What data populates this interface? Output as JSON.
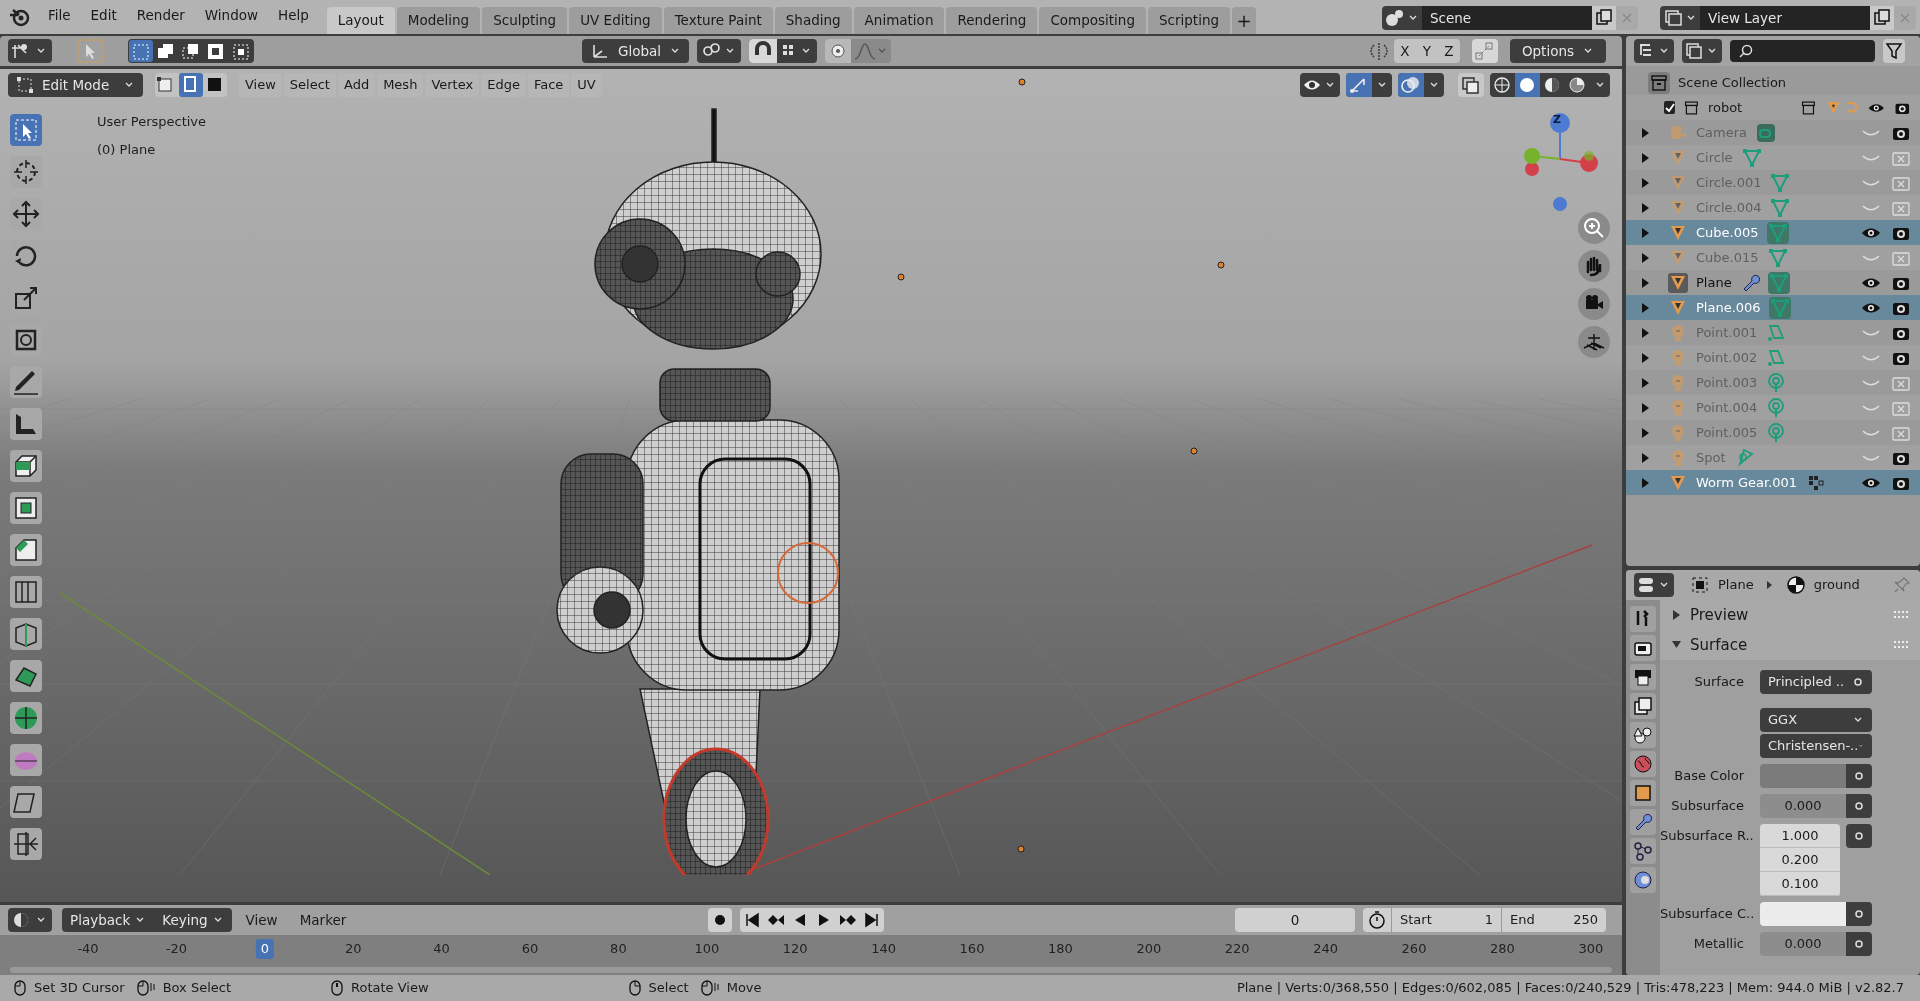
{
  "top_bar": {
    "menus": [
      "File",
      "Edit",
      "Render",
      "Window",
      "Help"
    ],
    "workspaces": [
      {
        "label": "Layout",
        "selected": true
      },
      {
        "label": "Modeling",
        "selected": false
      },
      {
        "label": "Sculpting",
        "selected": false
      },
      {
        "label": "UV Editing",
        "selected": false
      },
      {
        "label": "Texture Paint",
        "selected": false
      },
      {
        "label": "Shading",
        "selected": false
      },
      {
        "label": "Animation",
        "selected": false
      },
      {
        "label": "Rendering",
        "selected": false
      },
      {
        "label": "Compositing",
        "selected": false
      },
      {
        "label": "Scripting",
        "selected": false
      }
    ],
    "add_tab": "+",
    "scene": "Scene",
    "view_layer": "View Layer"
  },
  "viewport": {
    "orientation": "Global",
    "axes": [
      "X",
      "Y",
      "Z"
    ],
    "options": "Options",
    "mode": "Edit Mode",
    "select_modes": [
      {
        "selected": false
      },
      {
        "selected": true
      },
      {
        "selected": false
      }
    ],
    "menus": [
      "View",
      "Select",
      "Add",
      "Mesh",
      "Vertex",
      "Edge",
      "Face",
      "UV"
    ],
    "shading": [
      {
        "selected": false
      },
      {
        "selected": true
      },
      {
        "selected": false
      },
      {
        "selected": false
      }
    ],
    "toggles": {
      "gizmos": true,
      "overlays": true,
      "xray": false
    },
    "overlay_text": [
      "User Perspective",
      "(0) Plane"
    ],
    "gizmo_label": "Z",
    "tools": [
      {
        "kind": "select",
        "selected": true
      },
      {
        "kind": "cursor",
        "selected": false
      },
      {
        "kind": "move",
        "selected": false
      },
      {
        "kind": "rotate",
        "selected": false
      },
      {
        "kind": "scale",
        "selected": false
      },
      {
        "kind": "transform",
        "selected": false
      },
      {
        "kind": "annotate",
        "selected": false
      },
      {
        "kind": "measure",
        "selected": false
      },
      {
        "kind": "extrude",
        "selected": false
      },
      {
        "kind": "inset",
        "selected": false
      },
      {
        "kind": "bevel",
        "selected": false
      },
      {
        "kind": "loopcut",
        "selected": false
      },
      {
        "kind": "knife",
        "selected": false
      },
      {
        "kind": "polybuild",
        "selected": false
      },
      {
        "kind": "spin",
        "selected": false
      },
      {
        "kind": "smooth",
        "selected": false
      },
      {
        "kind": "shear",
        "selected": false
      },
      {
        "kind": "rip",
        "selected": false
      }
    ]
  },
  "outliner": {
    "root": "Scene Collection",
    "collection": {
      "name": "robot",
      "checked": true,
      "children": [
        {
          "name": "Camera",
          "kind": "camera",
          "data": {
            "kind": "camera"
          },
          "visible": false,
          "renderable": true,
          "selected": false,
          "active": false
        },
        {
          "name": "Circle",
          "kind": "mesh",
          "data": {
            "kind": "mesh"
          },
          "visible": false,
          "renderable": false,
          "selected": false,
          "active": false
        },
        {
          "name": "Circle.001",
          "kind": "mesh",
          "data": {
            "kind": "mesh"
          },
          "visible": false,
          "renderable": false,
          "selected": false,
          "active": false
        },
        {
          "name": "Circle.004",
          "kind": "mesh",
          "data": {
            "kind": "mesh"
          },
          "visible": false,
          "renderable": false,
          "selected": false,
          "active": false
        },
        {
          "name": "Cube.005",
          "kind": "mesh",
          "data": {
            "kind": "mesh"
          },
          "visible": true,
          "renderable": true,
          "selected": true,
          "active": false
        },
        {
          "name": "Cube.015",
          "kind": "mesh",
          "data": {
            "kind": "mesh"
          },
          "visible": false,
          "renderable": false,
          "selected": false,
          "active": false
        },
        {
          "name": "Plane",
          "kind": "mesh",
          "data": {
            "kind": "mesh"
          },
          "modifier": true,
          "visible": true,
          "renderable": true,
          "selected": false,
          "active": true
        },
        {
          "name": "Plane.006",
          "kind": "mesh",
          "data": {
            "kind": "mesh"
          },
          "visible": true,
          "renderable": true,
          "selected": true,
          "active": false
        },
        {
          "name": "Point.001",
          "kind": "light",
          "data": {
            "kind": "area"
          },
          "visible": false,
          "renderable": true,
          "selected": false,
          "active": false
        },
        {
          "name": "Point.002",
          "kind": "light",
          "data": {
            "kind": "area"
          },
          "visible": false,
          "renderable": true,
          "selected": false,
          "active": false
        },
        {
          "name": "Point.003",
          "kind": "light",
          "data": {
            "kind": "point"
          },
          "visible": false,
          "renderable": false,
          "selected": false,
          "active": false
        },
        {
          "name": "Point.004",
          "kind": "light",
          "data": {
            "kind": "point"
          },
          "visible": false,
          "renderable": false,
          "selected": false,
          "active": false
        },
        {
          "name": "Point.005",
          "kind": "light",
          "data": {
            "kind": "point"
          },
          "visible": false,
          "renderable": false,
          "selected": false,
          "active": false
        },
        {
          "name": "Spot",
          "kind": "light",
          "data": {
            "kind": "spot"
          },
          "visible": false,
          "renderable": true,
          "selected": false,
          "active": false
        },
        {
          "name": "Worm Gear.001",
          "kind": "mesh",
          "data": {
            "kind": "grid"
          },
          "visible": true,
          "renderable": true,
          "selected": true,
          "active": false
        }
      ]
    }
  },
  "properties": {
    "object": "Plane",
    "material": "ground",
    "panels": [
      {
        "title": "Preview",
        "expanded": false
      },
      {
        "title": "Surface",
        "expanded": true
      }
    ],
    "fields": [
      {
        "kind": "link",
        "label": "Surface",
        "value": "Principled .."
      },
      {
        "kind": "dropdown",
        "value": "GGX"
      },
      {
        "kind": "dropdown",
        "value": "Christensen-.."
      },
      {
        "kind": "color",
        "label": "Base Color",
        "color": "#7b7b7b"
      },
      {
        "kind": "number",
        "label": "Subsurface",
        "value": "0.000"
      },
      {
        "kind": "vector",
        "label": "Subsurface R..",
        "values": [
          "1.000",
          "0.200",
          "0.100"
        ]
      },
      {
        "kind": "color",
        "label": "Subsurface C..",
        "color": "#ececec"
      },
      {
        "kind": "number",
        "label": "Metallic",
        "value": "0.000"
      }
    ]
  },
  "timeline": {
    "menus": [
      "Playback",
      "Keying"
    ],
    "plain_menus": [
      "View",
      "Marker"
    ],
    "current_frame": "0",
    "start_label": "Start",
    "start": "1",
    "end_label": "End",
    "end": "250",
    "ruler": [
      {
        "label": "-40",
        "selected": false
      },
      {
        "label": "-20",
        "selected": false
      },
      {
        "label": "0",
        "selected": true
      },
      {
        "label": "20",
        "selected": false
      },
      {
        "label": "40",
        "selected": false
      },
      {
        "label": "60",
        "selected": false
      },
      {
        "label": "80",
        "selected": false
      },
      {
        "label": "100",
        "selected": false
      },
      {
        "label": "120",
        "selected": false
      },
      {
        "label": "140",
        "selected": false
      },
      {
        "label": "160",
        "selected": false
      },
      {
        "label": "180",
        "selected": false
      },
      {
        "label": "200",
        "selected": false
      },
      {
        "label": "220",
        "selected": false
      },
      {
        "label": "240",
        "selected": false
      },
      {
        "label": "260",
        "selected": false
      },
      {
        "label": "280",
        "selected": false
      },
      {
        "label": "300",
        "selected": false
      }
    ]
  },
  "status_bar": {
    "hints": [
      "Set 3D Cursor",
      "Box Select",
      "Rotate View",
      "Select",
      "Move"
    ],
    "stats": "Plane | Verts:0/368,550 | Edges:0/602,085 | Faces:0/240,529 | Tris:478,223 | Mem: 944.0 MiB | v2.82.7"
  }
}
